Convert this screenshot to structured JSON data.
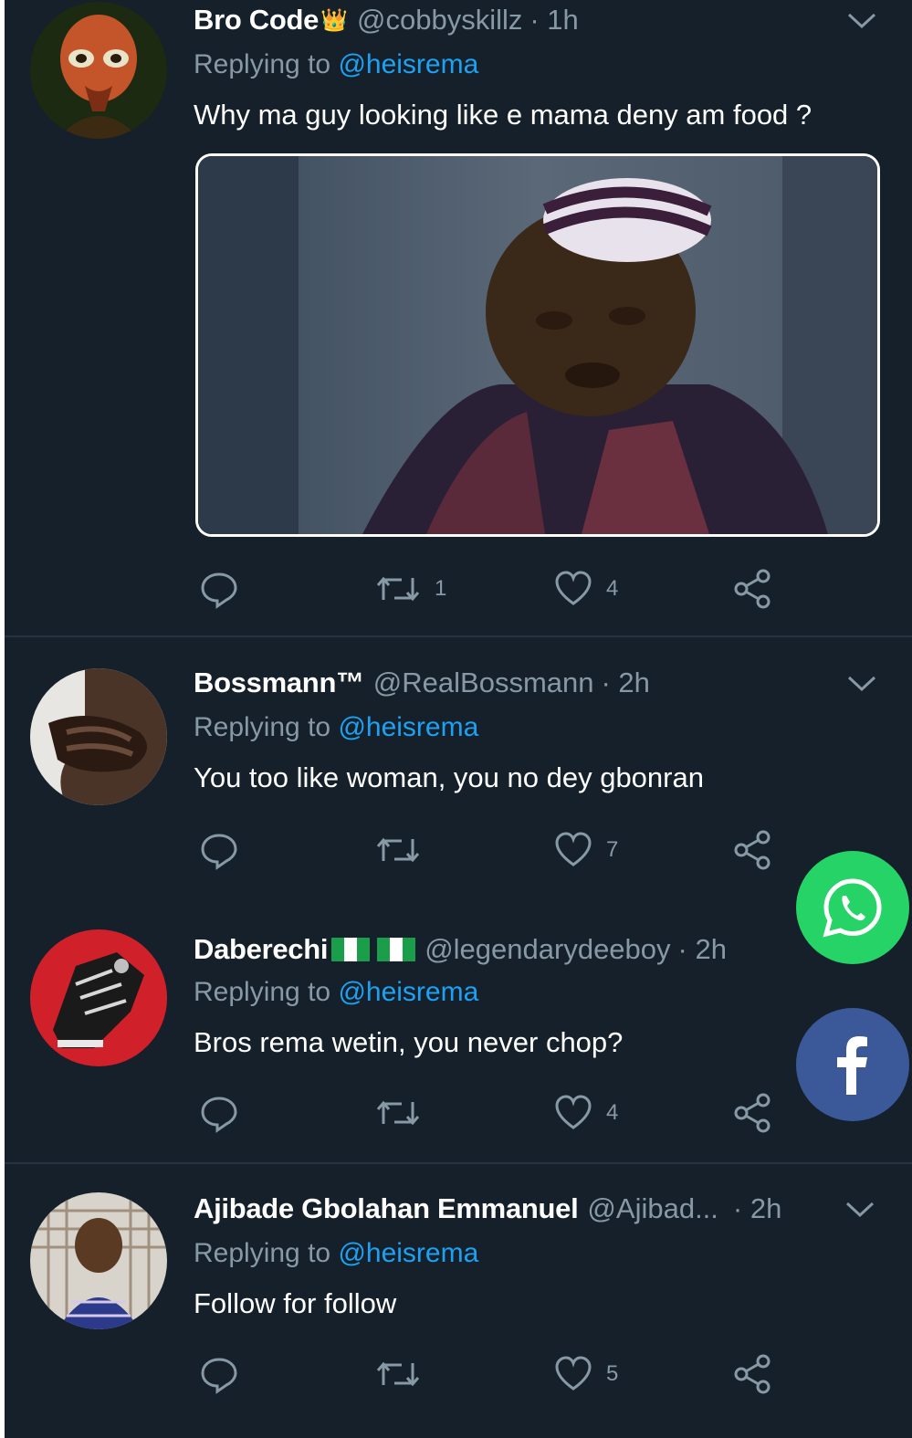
{
  "tweets": [
    {
      "name": "Bro Code",
      "name_badge": "👑",
      "handle": "@cobbyskillz",
      "time": "· 1h",
      "replying_prefix": "Replying to ",
      "replying_to": "@heisrema",
      "text": "Why ma guy looking like e mama deny am food ?",
      "has_media": true,
      "actions": {
        "reply": "",
        "retweet": "1",
        "like": "4"
      },
      "avatar_icon": "alien-avatar-icon"
    },
    {
      "name": "Bossmann™",
      "handle": "@RealBossmann",
      "time": "· 2h",
      "replying_prefix": "Replying to ",
      "replying_to": "@heisrema",
      "text": "You too like woman, you no dey gbonran",
      "actions": {
        "reply": "",
        "retweet": "",
        "like": "7"
      },
      "avatar_icon": "hand-avatar-icon"
    },
    {
      "name": "Daberechi",
      "handle": "@legendarydeeboy",
      "time": "· 2h",
      "replying_prefix": "Replying to ",
      "replying_to": "@heisrema",
      "text": "Bros rema wetin, you never chop?",
      "actions": {
        "reply": "",
        "retweet": "",
        "like": "4"
      },
      "avatar_icon": "shoe-avatar-icon"
    },
    {
      "name": "Ajibade Gbolahan Emmanuel",
      "handle": "@Ajibad...",
      "time": "· 2h",
      "replying_prefix": "Replying to ",
      "replying_to": "@heisrema",
      "text": "Follow for follow",
      "actions": {
        "reply": "",
        "retweet": "",
        "like": "5"
      },
      "avatar_icon": "person-avatar-icon"
    }
  ],
  "share_buttons": [
    {
      "name": "whatsapp",
      "icon": "whatsapp-icon",
      "color": "#25d366"
    },
    {
      "name": "facebook",
      "icon": "facebook-icon",
      "color": "#3b5998"
    }
  ],
  "colors": {
    "background": "#15202b",
    "divider": "#263340",
    "muted": "#8899a6",
    "mention": "#1da1f2"
  }
}
